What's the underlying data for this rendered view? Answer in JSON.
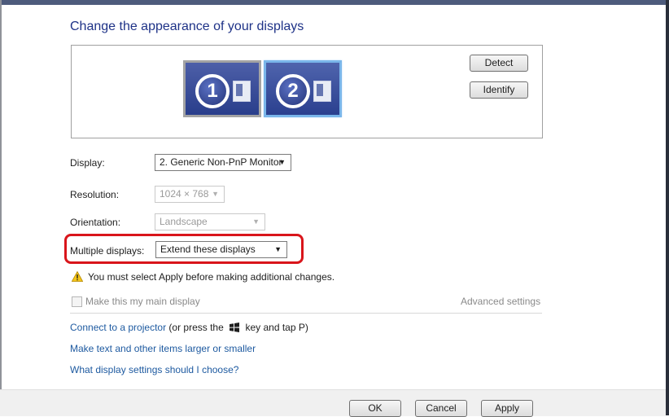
{
  "page": {
    "heading": "Change the appearance of your displays"
  },
  "preview": {
    "monitors": [
      {
        "number": "1",
        "selected": false
      },
      {
        "number": "2",
        "selected": true
      }
    ],
    "detect_label": "Detect",
    "identify_label": "Identify"
  },
  "settings": {
    "display": {
      "label": "Display:",
      "value": "2. Generic Non-PnP Monitor"
    },
    "resolution": {
      "label": "Resolution:",
      "value": "1024 × 768",
      "disabled": true
    },
    "orientation": {
      "label": "Orientation:",
      "value": "Landscape",
      "disabled": true
    },
    "multiple_displays": {
      "label": "Multiple displays:",
      "value": "Extend these displays",
      "highlighted": true
    }
  },
  "warning": {
    "icon": "warning-icon",
    "text": "You must select Apply before making additional changes."
  },
  "main_display_checkbox": {
    "label": "Make this my main display",
    "checked": false,
    "disabled": true
  },
  "advanced_settings_label": "Advanced settings",
  "links": {
    "projector": {
      "link_text": "Connect to a projector",
      "text_before_key": "(or press the",
      "text_after_key": "key and tap P)",
      "key_icon": "windows-logo-icon"
    },
    "larger_text": "Make text and other items larger or smaller",
    "which_settings": "What display settings should I choose?"
  },
  "footer": {
    "ok_label": "OK",
    "cancel_label": "Cancel",
    "apply_label": "Apply"
  },
  "colors": {
    "heading": "#1e3287",
    "link": "#1e5aa0",
    "highlight_border": "#d9151b",
    "monitor_fill": "#2b408f"
  }
}
